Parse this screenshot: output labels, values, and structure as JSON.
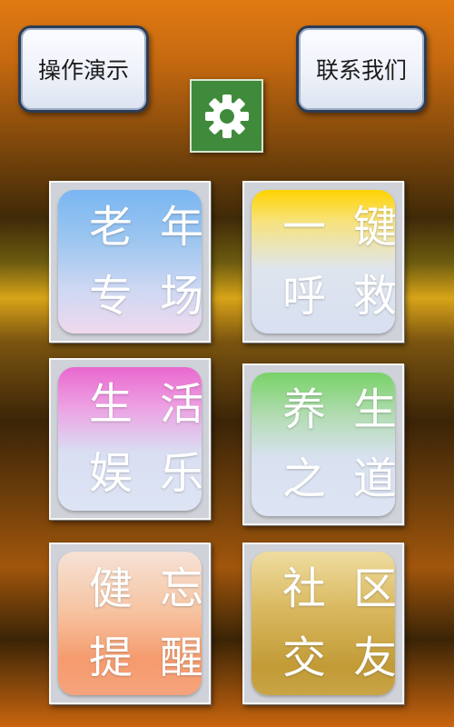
{
  "header": {
    "demo_label": "操作演示",
    "contact_label": "联系我们",
    "settings_icon": "gear-icon"
  },
  "tiles": [
    {
      "line1": "老年",
      "line2": "专场"
    },
    {
      "line1": "一键",
      "line2": "呼救"
    },
    {
      "line1": "生活",
      "line2": "娱乐"
    },
    {
      "line1": "养生",
      "line2": "之道"
    },
    {
      "line1": "健忘",
      "line2": "提醒"
    },
    {
      "line1": "社区",
      "line2": "交友"
    }
  ],
  "colors": {
    "settings_bg": "#3f8a3b",
    "tile_blue": "#7ab6f2",
    "tile_yellow": "#ffd300",
    "tile_pink": "#ea68cf",
    "tile_green": "#78d267",
    "tile_orange": "#f59b6d",
    "tile_gold": "#c29b36"
  }
}
